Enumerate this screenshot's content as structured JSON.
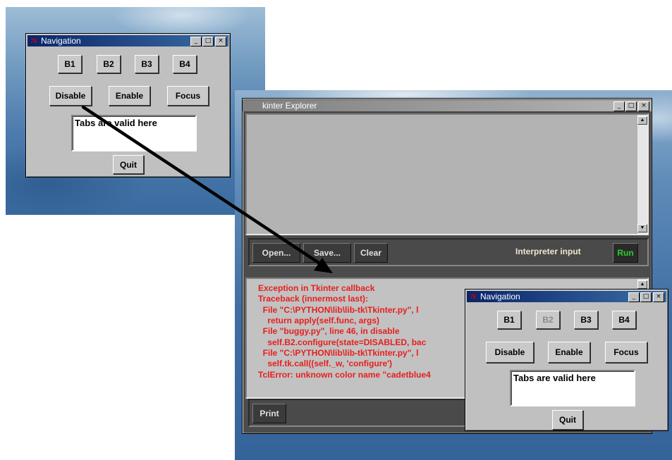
{
  "nav_window_1": {
    "title": "Navigation",
    "tk_icon_label": "7k",
    "window_controls": {
      "minimize": "_",
      "maximize": "□",
      "close": "×"
    },
    "buttons": [
      "B1",
      "B2",
      "B3",
      "B4"
    ],
    "actions": [
      "Disable",
      "Enable",
      "Focus"
    ],
    "entry_text": "Tabs are valid here",
    "quit_label": "Quit"
  },
  "explorer_window": {
    "title": "kinter Explorer",
    "window_controls": {
      "minimize": "_",
      "maximize": "□",
      "close": "×"
    },
    "toolbar": {
      "open_label": "Open...",
      "save_label": "Save...",
      "clear_label": "Clear",
      "interpreter_label": "Interpreter input",
      "run_label": "Run"
    },
    "output_lines": [
      "Exception in Tkinter callback",
      "Traceback (innermost last):",
      "  File \"C:\\PYTHON\\lib\\lib-tk\\Tkinter.py\", l",
      "    return apply(self.func, args)",
      "  File \"buggy.py\", line 46, in disable",
      "    self.B2.configure(state=DISABLED, bac",
      "  File \"C:\\PYTHON\\lib\\lib-tk\\Tkinter.py\", l",
      "    self.tk.call((self._w, 'configure')",
      "TclError: unknown color name \"cadetblue4"
    ],
    "print_label": "Print"
  },
  "nav_window_2": {
    "title": "Navigation",
    "tk_icon_label": "7k",
    "window_controls": {
      "minimize": "_",
      "maximize": "□",
      "close": "×"
    },
    "buttons": [
      "B1",
      "B2",
      "B3",
      "B4"
    ],
    "disabled_button": "B2",
    "actions": [
      "Disable",
      "Enable",
      "Focus"
    ],
    "entry_text": "Tabs are valid here",
    "quit_label": "Quit"
  },
  "colors": {
    "error_text": "#e81e1e",
    "run_text": "#2ecc2e",
    "interpreter_label": "#f0e6d0",
    "arrow": "#000000",
    "disabled_text": "#8a8a8a"
  }
}
